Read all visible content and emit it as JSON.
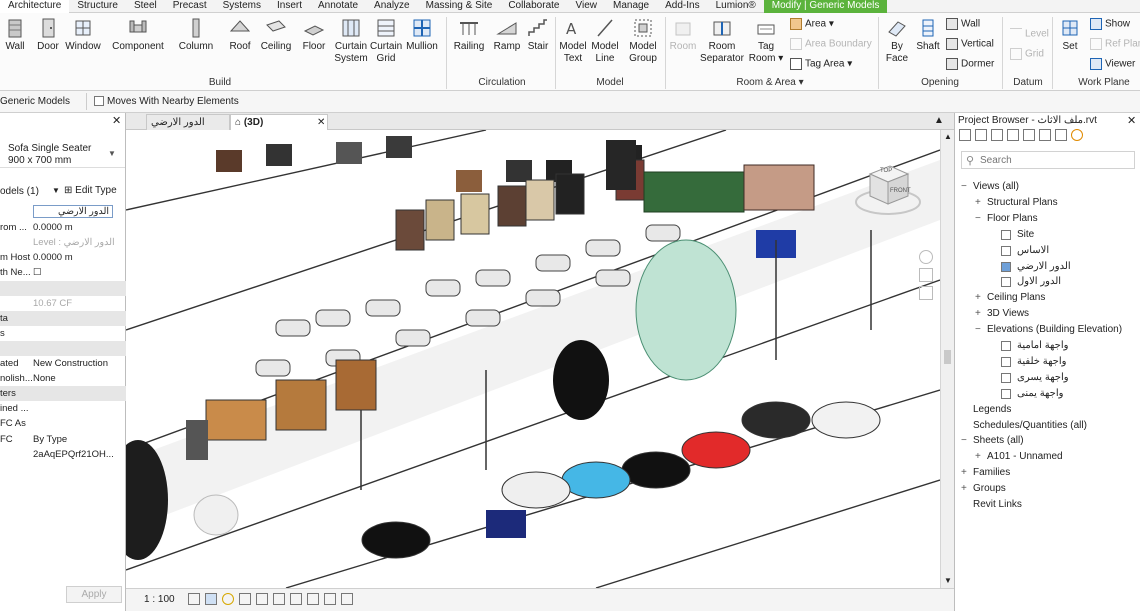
{
  "ribbon_tabs": [
    "Architecture",
    "Structure",
    "Steel",
    "Precast",
    "Systems",
    "Insert",
    "Annotate",
    "Analyze",
    "Massing & Site",
    "Collaborate",
    "View",
    "Manage",
    "Add-Ins",
    "Lumion®",
    "Modify | Generic Models"
  ],
  "ribbon": {
    "build": {
      "label": "Build",
      "wall": "Wall",
      "door": "Door",
      "window": "Window",
      "component": "Component",
      "column": "Column",
      "roof": "Roof",
      "ceiling": "Ceiling",
      "floor": "Floor",
      "curtain_system": "Curtain System",
      "curtain_grid": "Curtain Grid",
      "mullion": "Mullion"
    },
    "circulation": {
      "label": "Circulation",
      "railing": "Railing",
      "ramp": "Ramp",
      "stair": "Stair"
    },
    "model": {
      "label": "Model",
      "model_text": "Model Text",
      "model_line": "Model Line",
      "model_group": "Model Group"
    },
    "room_area": {
      "label": "Room & Area ▾",
      "room": "Room",
      "room_separator": "Room Separator",
      "tag_room": "Tag Room ▾",
      "area": "Area ▾",
      "area_boundary": "Area Boundary",
      "tag_area": "Tag Area ▾"
    },
    "opening": {
      "label": "Opening",
      "by_face": "By Face",
      "shaft": "Shaft",
      "wall": "Wall",
      "vertical": "Vertical",
      "dormer": "Dormer"
    },
    "datum": {
      "label": "Datum",
      "level": "Level",
      "grid": "Grid"
    },
    "work_plane": {
      "label": "Work Plane",
      "set": "Set",
      "show": "Show",
      "ref_plane": "Ref Plane",
      "viewer": "Viewer"
    }
  },
  "options_bar": {
    "context": "Generic Models",
    "moves_with": "Moves With Nearby Elements"
  },
  "properties": {
    "type_name": "Sofa Single Seater",
    "type_size": "900 x 700 mm",
    "selector": "odels (1)",
    "edit_type": "Edit Type",
    "rows": [
      {
        "k": "",
        "v": "الدور الارضي",
        "kind": "field"
      },
      {
        "k": "rom ...",
        "v": "0.0000 m"
      },
      {
        "k": "",
        "v": "Level : الدور الارضي",
        "kind": "dim"
      },
      {
        "k": "m Host",
        "v": "0.0000 m"
      },
      {
        "k": "th Ne...",
        "v": "☐"
      },
      {
        "k": "",
        "v": "",
        "kind": "hdr"
      },
      {
        "k": "",
        "v": "10.67 CF",
        "kind": "dim"
      },
      {
        "k": "ta",
        "v": "",
        "kind": "hdr"
      },
      {
        "k": "s",
        "v": ""
      },
      {
        "k": "",
        "v": "",
        "kind": "hdr"
      },
      {
        "k": "ated",
        "v": "New Construction"
      },
      {
        "k": "nolish...",
        "v": "None"
      },
      {
        "k": "ters",
        "v": "",
        "kind": "hdr"
      },
      {
        "k": "ined ...",
        "v": ""
      },
      {
        "k": "FC As",
        "v": ""
      },
      {
        "k": "FC",
        "v": "By Type"
      },
      {
        "k": "",
        "v": "2aAqEPQrf21OH..."
      }
    ],
    "apply": "Apply"
  },
  "view_tabs": [
    {
      "label": "الدور الارضي"
    },
    {
      "label": "(3D)"
    }
  ],
  "viewcube": {
    "top": "TOP",
    "front": "FRONT"
  },
  "view_scale": "1 : 100",
  "browser": {
    "title": "Project Browser - ملف الاثاث.rvt",
    "search_placeholder": "Search",
    "items": [
      {
        "label": "Views (all)",
        "indent": 0,
        "tog": "−"
      },
      {
        "label": "Structural Plans",
        "indent": 1,
        "tog": "+"
      },
      {
        "label": "Floor Plans",
        "indent": 1,
        "tog": "−"
      },
      {
        "label": "Site",
        "indent": 2,
        "box": true
      },
      {
        "label": "الاساس",
        "indent": 2,
        "box": true
      },
      {
        "label": "الدور الارضي",
        "indent": 2,
        "box": true,
        "sel": true
      },
      {
        "label": "الدور الاول",
        "indent": 2,
        "box": true
      },
      {
        "label": "Ceiling Plans",
        "indent": 1,
        "tog": "+"
      },
      {
        "label": "3D Views",
        "indent": 1,
        "tog": "+"
      },
      {
        "label": "Elevations (Building Elevation)",
        "indent": 1,
        "tog": "−"
      },
      {
        "label": "واجهة امامية",
        "indent": 2,
        "box": true
      },
      {
        "label": "واجهة خلفية",
        "indent": 2,
        "box": true
      },
      {
        "label": "واجهة يسرى",
        "indent": 2,
        "box": true
      },
      {
        "label": "واجهة يمنى",
        "indent": 2,
        "box": true
      },
      {
        "label": "Legends",
        "indent": 0,
        "tog": ""
      },
      {
        "label": "Schedules/Quantities (all)",
        "indent": 0,
        "tog": ""
      },
      {
        "label": "Sheets (all)",
        "indent": 0,
        "tog": "−"
      },
      {
        "label": "A101 - Unnamed",
        "indent": 1,
        "tog": "+"
      },
      {
        "label": "Families",
        "indent": 0,
        "tog": "+"
      },
      {
        "label": "Groups",
        "indent": 0,
        "tog": "+"
      },
      {
        "label": "Revit Links",
        "indent": 0,
        "tog": ""
      }
    ]
  },
  "colors": {
    "modify_tab": "#5bb33c",
    "accent": "#1e64b4"
  }
}
